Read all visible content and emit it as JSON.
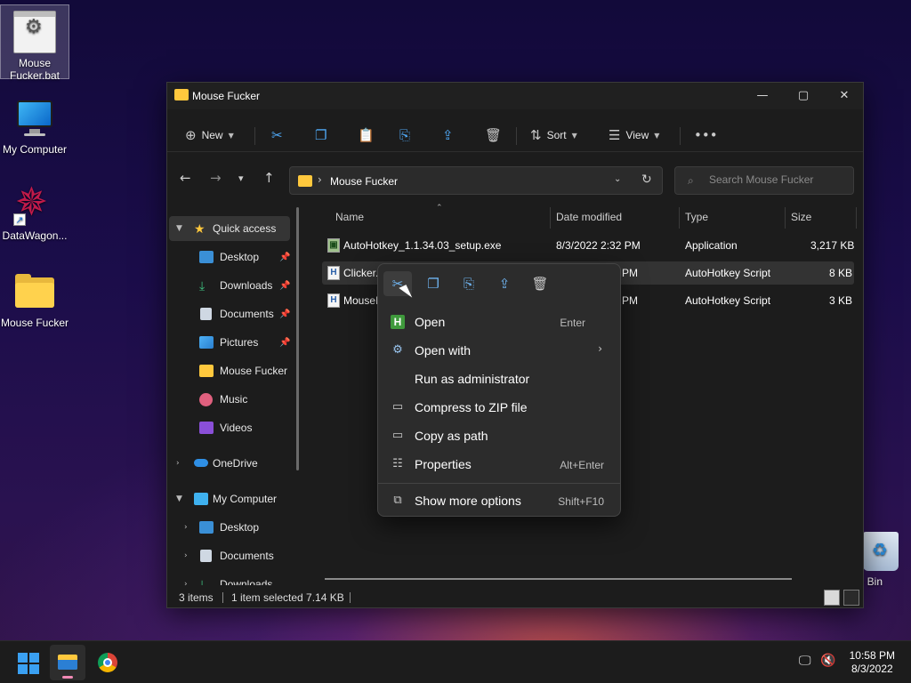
{
  "desktop": {
    "icons": [
      {
        "label": "Mouse Fucker.bat",
        "icon": "batch-file-icon"
      },
      {
        "label": "My Computer",
        "icon": "monitor-icon"
      },
      {
        "label": "DataWagon...",
        "icon": "datawagon-shortcut-icon"
      },
      {
        "label": "Mouse Fucker",
        "icon": "folder-icon"
      }
    ],
    "recycle_bin_label": "cle Bin"
  },
  "window": {
    "title": "Mouse Fucker",
    "controls": {
      "minimize": "—",
      "maximize": "▢",
      "close": "✕"
    }
  },
  "toolbar": {
    "new_label": "New",
    "sort_label": "Sort",
    "view_label": "View",
    "more": "•••"
  },
  "address": {
    "path": "Mouse Fucker",
    "search_placeholder": "Search Mouse Fucker"
  },
  "nav_pane": {
    "items": [
      {
        "label": "Quick access"
      },
      {
        "label": "Desktop"
      },
      {
        "label": "Downloads"
      },
      {
        "label": "Documents"
      },
      {
        "label": "Pictures"
      },
      {
        "label": "Mouse Fucker"
      },
      {
        "label": "Music"
      },
      {
        "label": "Videos"
      },
      {
        "label": "OneDrive"
      },
      {
        "label": "My Computer"
      },
      {
        "label": "Desktop"
      },
      {
        "label": "Documents"
      },
      {
        "label": "Downloads"
      }
    ]
  },
  "file_list": {
    "columns": [
      "Name",
      "Date modified",
      "Type",
      "Size"
    ],
    "rows": [
      {
        "name": "AutoHotkey_1.1.34.03_setup.exe",
        "date": "8/3/2022 2:32 PM",
        "type": "Application",
        "size": "3,217 KB"
      },
      {
        "name": "Clicker.",
        "date": "PM",
        "type": "AutoHotkey Script",
        "size": "8 KB"
      },
      {
        "name": "MouseI",
        "date": "PM",
        "type": "AutoHotkey Script",
        "size": "3 KB"
      }
    ]
  },
  "status": {
    "count": "3 items",
    "selection": "1 item selected  7.14 KB"
  },
  "context_menu": {
    "items": [
      {
        "label": "Open",
        "shortcut": "Enter"
      },
      {
        "label": "Open with",
        "shortcut": ""
      },
      {
        "label": "Run as administrator",
        "shortcut": ""
      },
      {
        "label": "Compress to ZIP file",
        "shortcut": ""
      },
      {
        "label": "Copy as path",
        "shortcut": ""
      },
      {
        "label": "Properties",
        "shortcut": "Alt+Enter"
      },
      {
        "label": "Show more options",
        "shortcut": "Shift+F10"
      }
    ]
  },
  "taskbar": {
    "time": "10:58 PM",
    "date": "8/3/2022"
  },
  "colors": {
    "accent": "#4fa8f5",
    "folder": "#ffc83d",
    "window_bg": "#1c1c1c",
    "menu_bg": "#2c2c2c"
  }
}
